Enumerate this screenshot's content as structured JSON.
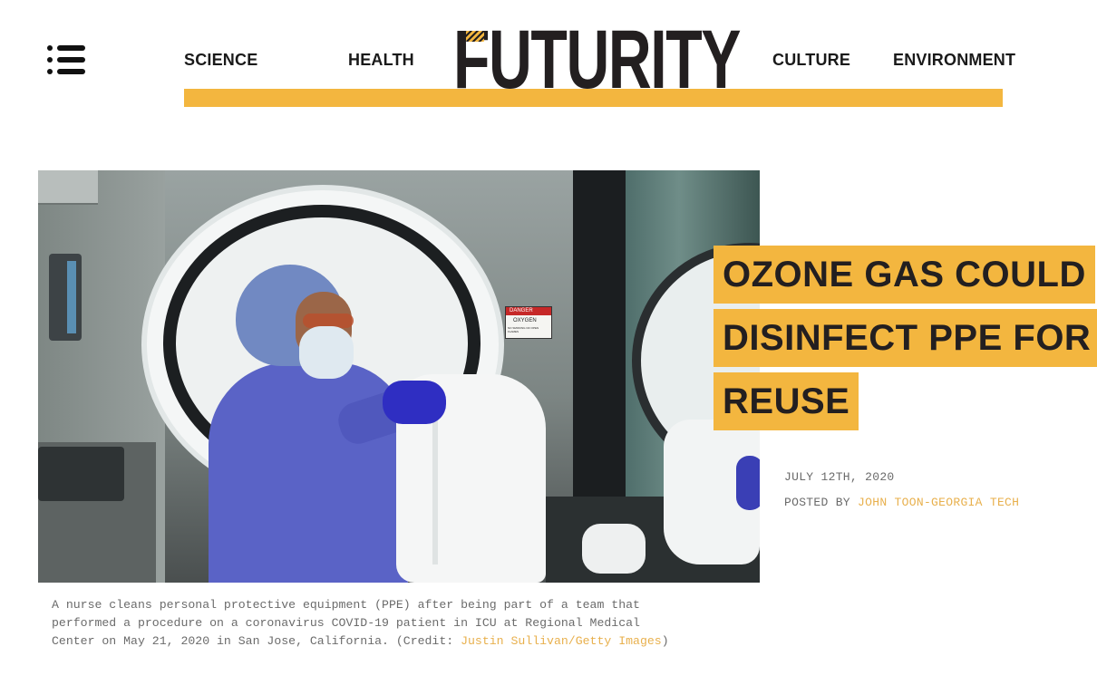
{
  "header": {
    "logo_text": "FUTURITY",
    "nav": {
      "science": "SCIENCE",
      "health": "HEALTH",
      "culture": "CULTURE",
      "environment": "ENVIRONMENT"
    },
    "menu_icon": "list-icon",
    "accent_color": "#f3b63f"
  },
  "article": {
    "title_lines": [
      "OZONE GAS COULD",
      "DISINFECT PPE FOR",
      "REUSE"
    ],
    "date": "JULY 12TH, 2020",
    "posted_by_label": "POSTED BY",
    "author": "JOHN TOON-GEORGIA TECH",
    "caption": {
      "text": "A nurse cleans personal protective equipment (PPE) after being part of a team that performed a procedure on a coronavirus COVID-19 patient in ICU at Regional Medical Center on May 21, 2020 in San Jose, California. (Credit: ",
      "credit_link": "Justin Sullivan/Getty Images",
      "close": ")"
    },
    "image_sign": {
      "top": "DANGER",
      "middle": "OXYGEN",
      "bottom": "NO SMOKING NO OPEN FLAMES"
    }
  }
}
